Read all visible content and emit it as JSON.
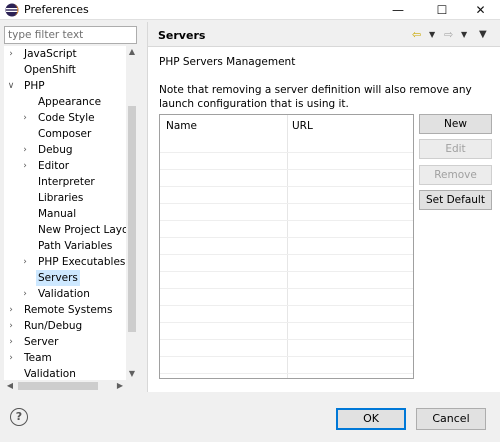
{
  "window": {
    "title": "Preferences",
    "minimize_glyph": "—",
    "maximize_glyph": "☐",
    "close_glyph": "✕"
  },
  "filter": {
    "placeholder": "type filter text",
    "value": ""
  },
  "tree": {
    "items": [
      {
        "label": "JavaScript",
        "arrow": "right",
        "selected": false
      },
      {
        "label": "OpenShift",
        "arrow": "none",
        "selected": false
      },
      {
        "label": "PHP",
        "arrow": "down",
        "selected": false
      },
      {
        "label": "Appearance",
        "arrow": "none",
        "selected": false
      },
      {
        "label": "Code Style",
        "arrow": "right",
        "selected": false
      },
      {
        "label": "Composer",
        "arrow": "none",
        "selected": false
      },
      {
        "label": "Debug",
        "arrow": "right",
        "selected": false
      },
      {
        "label": "Editor",
        "arrow": "right",
        "selected": false
      },
      {
        "label": "Interpreter",
        "arrow": "none",
        "selected": false
      },
      {
        "label": "Libraries",
        "arrow": "none",
        "selected": false
      },
      {
        "label": "Manual",
        "arrow": "none",
        "selected": false
      },
      {
        "label": "New Project Layout",
        "arrow": "none",
        "selected": false
      },
      {
        "label": "Path Variables",
        "arrow": "none",
        "selected": false
      },
      {
        "label": "PHP Executables",
        "arrow": "right",
        "selected": false
      },
      {
        "label": "Servers",
        "arrow": "none",
        "selected": true
      },
      {
        "label": "Validation",
        "arrow": "right",
        "selected": false
      },
      {
        "label": "Remote Systems",
        "arrow": "right",
        "selected": false
      },
      {
        "label": "Run/Debug",
        "arrow": "right",
        "selected": false
      },
      {
        "label": "Server",
        "arrow": "right",
        "selected": false
      },
      {
        "label": "Team",
        "arrow": "right",
        "selected": false
      },
      {
        "label": "Validation",
        "arrow": "none",
        "selected": false
      }
    ]
  },
  "panel": {
    "title": "Servers",
    "section_title": "PHP Servers Management",
    "note": "Note that removing a server definition will also remove any launch configuration that is using it.",
    "table": {
      "columns": [
        "Name",
        "URL"
      ],
      "rows": []
    },
    "buttons": {
      "new": "New",
      "edit": "Edit",
      "remove": "Remove",
      "set_default": "Set Default"
    }
  },
  "footer": {
    "help_glyph": "?",
    "ok": "OK",
    "cancel": "Cancel"
  },
  "colors": {
    "accent": "#0078d7",
    "selection": "#cde8ff",
    "nav_arrow": "#c9a800"
  },
  "icons": [
    "eclipse-icon",
    "back-arrow-icon",
    "forward-arrow-icon",
    "view-menu-icon",
    "help-icon"
  ]
}
